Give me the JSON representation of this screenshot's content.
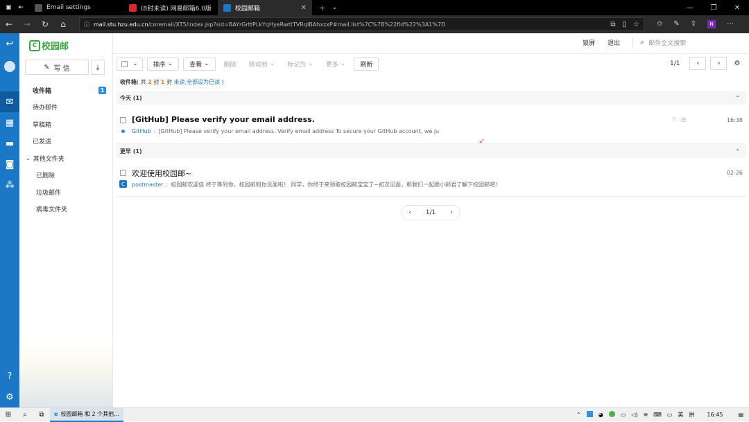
{
  "browser": {
    "tabs": [
      {
        "label": "Email settings",
        "active": false
      },
      {
        "label": "(8封未读) 网易邮箱6.0版",
        "active": false
      },
      {
        "label": "校园邮箱",
        "active": true
      }
    ],
    "url_domain": "mail.stu.hzu.edu.cn",
    "url_rest": "/coremail/XT5/index.jsp?sid=BAYrGrttPLkYqHyeRwttTVRqIBAhxzxP#mail.list%7C%7B%22fid%22%3A1%7D"
  },
  "app": {
    "logo_text": "校园邮",
    "lock_label": "锁屏",
    "logout_label": "退出",
    "search_placeholder": "邮件全文搜索",
    "compose_label": "写 信"
  },
  "folders": [
    {
      "label": "收件箱",
      "count": "1",
      "active": true
    },
    {
      "label": "待办邮件"
    },
    {
      "label": "草稿箱"
    },
    {
      "label": "已发送"
    },
    {
      "label": "其他文件夹",
      "group": true
    },
    {
      "label": "已删除",
      "sub": true
    },
    {
      "label": "垃圾邮件",
      "sub": true
    },
    {
      "label": "病毒文件夹",
      "sub": true
    }
  ],
  "toolbar": {
    "sort": "排序",
    "view": "查看",
    "delete": "删除",
    "move": "移动到",
    "mark": "标记为",
    "more": "更多",
    "refresh": "刷新",
    "page": "1/1"
  },
  "summary": {
    "folder": "收件箱",
    "open": "( 共",
    "total": "2",
    "total_unit": "封",
    "unread": "1",
    "unread_unit": "封",
    "unread_label": "未读",
    "mark_all": ",全部设为已读",
    "close": ")"
  },
  "groups": [
    {
      "label": "今天 (1)",
      "mails": [
        {
          "subject": "[GitHub] Please verify your email address.",
          "sender": "GitHub",
          "preview": "[GitHub] Please verify your email address. Verify email address To secure your GitHub account, we ju",
          "time": "16:38",
          "unread": true
        }
      ]
    },
    {
      "label": "更早 (1)",
      "mails": [
        {
          "subject": "欢迎使用校园邮~",
          "sender": "postmaster",
          "preview": "校园邮欢迎信 终于等到你，校园邮和你见面啦！ 同学，你终于来领取校园邮宝宝了~初次见面，那我们一起跟小邮君了解下校园邮吧！",
          "time": "02-26",
          "unread": false
        }
      ]
    }
  ],
  "bottom_pager": "1/1",
  "taskbar": {
    "app_label": "校园邮箱 和 2 个其他...",
    "ime_lang": "英",
    "ime_mode": "拼",
    "clock": "16:45"
  },
  "colors": {
    "rail": "#1b78c6",
    "brand_green": "#3aa640",
    "accent_blue": "#2b8fe0"
  }
}
